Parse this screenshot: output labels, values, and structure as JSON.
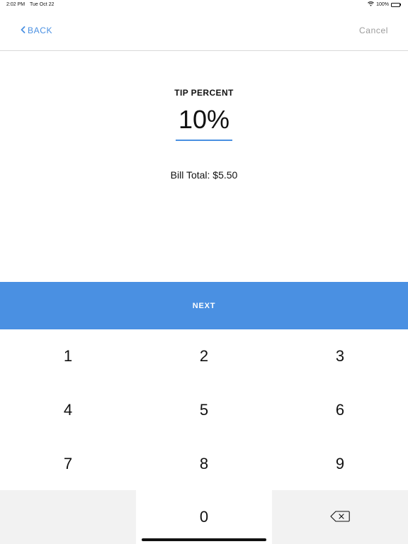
{
  "status_bar": {
    "time": "2:02 PM",
    "date": "Tue Oct 22",
    "battery": "100%",
    "wifi_icon": "wifi-icon",
    "battery_icon": "battery-icon"
  },
  "nav": {
    "back_label": "BACK",
    "back_icon": "chevron-left-icon",
    "cancel_label": "Cancel"
  },
  "tip": {
    "heading": "TIP PERCENT",
    "value": "10%"
  },
  "bill": {
    "total_label": "Bill Total: $5.50"
  },
  "next_label": "NEXT",
  "keypad": {
    "keys": [
      "1",
      "2",
      "3",
      "4",
      "5",
      "6",
      "7",
      "8",
      "9",
      "",
      "0",
      ""
    ],
    "delete_icon": "backspace-icon"
  },
  "colors": {
    "accent": "#4a90e2",
    "cancel_text": "#9b9b9b",
    "key_gray": "#f2f2f2"
  }
}
